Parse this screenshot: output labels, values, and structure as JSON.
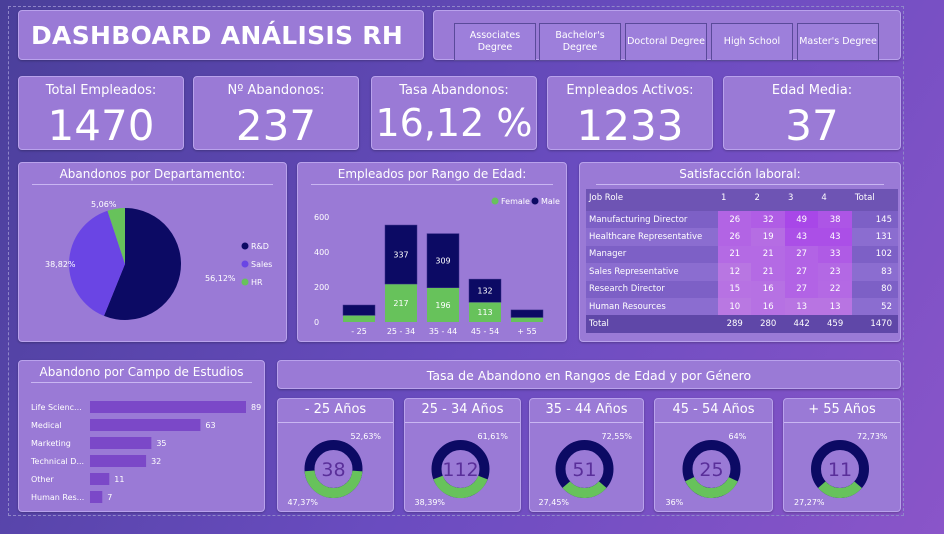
{
  "header": {
    "title": "DASHBOARD ANÁLISIS RH"
  },
  "education_filter": [
    "Associates Degree",
    "Bachelor's Degree",
    "Doctoral Degree",
    "High School",
    "Master's Degree"
  ],
  "kpis": [
    {
      "label": "Total Empleados:",
      "value": "1470"
    },
    {
      "label": "Nº Abandonos:",
      "value": "237"
    },
    {
      "label": "Tasa Abandonos:",
      "value": "16,12 %"
    },
    {
      "label": "Empleados Activos:",
      "value": "1233"
    },
    {
      "label": "Edad Media:",
      "value": "37"
    }
  ],
  "pie": {
    "title": "Abandonos por Departamento:",
    "slices": [
      {
        "name": "R&D",
        "value": 56.12,
        "label": "56,12%",
        "color": "#0c0a64"
      },
      {
        "name": "Sales",
        "value": 38.82,
        "label": "38,82%",
        "color": "#6a45e4"
      },
      {
        "name": "HR",
        "value": 5.06,
        "label": "5,06%",
        "color": "#67c25b"
      }
    ]
  },
  "age_chart": {
    "title": "Empleados por Rango de Edad:",
    "legend": [
      "Female",
      "Male"
    ],
    "colors": {
      "Female": "#67c25b",
      "Male": "#0c0a64"
    },
    "yticks": [
      "600",
      "400",
      "200",
      "0"
    ],
    "categories": [
      "- 25",
      "25 - 34",
      "35 - 44",
      "45 - 54",
      "+ 55"
    ],
    "female": [
      38,
      217,
      196,
      113,
      26
    ],
    "male": [
      59,
      337,
      309,
      132,
      43
    ],
    "female_labels": [
      "",
      "217",
      "196",
      "113",
      ""
    ],
    "male_labels": [
      "",
      "337",
      "309",
      "132",
      ""
    ]
  },
  "satisfaction": {
    "title": "Satisfacción laboral:",
    "headers": [
      "Job Role",
      "1",
      "2",
      "3",
      "4",
      "Total"
    ],
    "rows": [
      [
        "Manufacturing Director",
        "26",
        "32",
        "49",
        "38",
        "145"
      ],
      [
        "Healthcare Representative",
        "26",
        "19",
        "43",
        "43",
        "131"
      ],
      [
        "Manager",
        "21",
        "21",
        "27",
        "33",
        "102"
      ],
      [
        "Sales Representative",
        "12",
        "21",
        "27",
        "23",
        "83"
      ],
      [
        "Research Director",
        "15",
        "16",
        "27",
        "22",
        "80"
      ],
      [
        "Human Resources",
        "10",
        "16",
        "13",
        "13",
        "52"
      ]
    ],
    "total": [
      "Total",
      "289",
      "280",
      "442",
      "459",
      "1470"
    ]
  },
  "study_field": {
    "title": "Abandono por Campo de Estudios",
    "items": [
      {
        "label": "Life Scienc...",
        "value": 89
      },
      {
        "label": "Medical",
        "value": 63
      },
      {
        "label": "Marketing",
        "value": 35
      },
      {
        "label": "Technical D...",
        "value": 32
      },
      {
        "label": "Other",
        "value": 11
      },
      {
        "label": "Human Res...",
        "value": 7
      }
    ]
  },
  "gender_section": {
    "title": "Tasa de Abandono en Rangos de Edad y por Género",
    "donuts": [
      {
        "title": "- 25 Años",
        "center": "38",
        "male": 52.63,
        "female": 47.37,
        "male_label": "52,63%",
        "female_label": "47,37%"
      },
      {
        "title": "25 - 34 Años",
        "center": "112",
        "male": 61.61,
        "female": 38.39,
        "male_label": "61,61%",
        "female_label": "38,39%"
      },
      {
        "title": "35 - 44 Años",
        "center": "51",
        "male": 72.55,
        "female": 27.45,
        "male_label": "72,55%",
        "female_label": "27,45%"
      },
      {
        "title": "45 - 54 Años",
        "center": "25",
        "male": 64,
        "female": 36,
        "male_label": "64%",
        "female_label": "36%"
      },
      {
        "title": "+ 55 Años",
        "center": "11",
        "male": 72.73,
        "female": 27.27,
        "male_label": "72,73%",
        "female_label": "27,27%"
      }
    ]
  },
  "chart_data": [
    {
      "type": "pie",
      "title": "Abandonos por Departamento:",
      "categories": [
        "R&D",
        "Sales",
        "HR"
      ],
      "values": [
        56.12,
        38.82,
        5.06
      ]
    },
    {
      "type": "bar",
      "title": "Empleados por Rango de Edad:",
      "categories": [
        "- 25",
        "25 - 34",
        "35 - 44",
        "45 - 54",
        "+ 55"
      ],
      "series": [
        {
          "name": "Female",
          "values": [
            38,
            217,
            196,
            113,
            26
          ]
        },
        {
          "name": "Male",
          "values": [
            59,
            337,
            309,
            132,
            43
          ]
        }
      ],
      "ylim": [
        0,
        600
      ]
    },
    {
      "type": "bar",
      "title": "Abandono por Campo de Estudios",
      "categories": [
        "Life Scienc...",
        "Medical",
        "Marketing",
        "Technical D...",
        "Other",
        "Human Res..."
      ],
      "values": [
        89,
        63,
        35,
        32,
        11,
        7
      ]
    }
  ]
}
